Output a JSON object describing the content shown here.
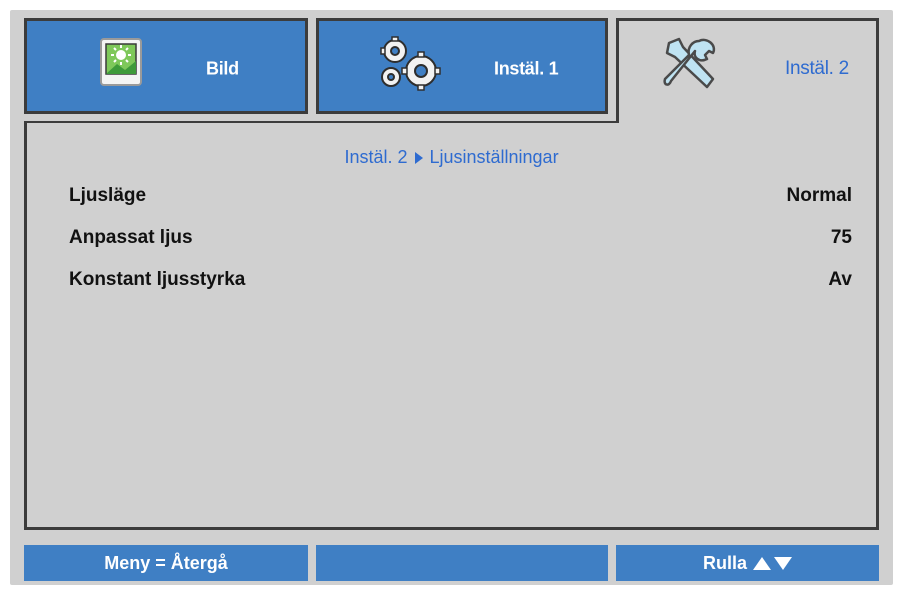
{
  "tabs": [
    {
      "label": "Bild",
      "icon": "picture-icon",
      "active": false
    },
    {
      "label": "Instäl. 1",
      "icon": "gears-icon",
      "active": false
    },
    {
      "label": "Instäl. 2",
      "icon": "tools-icon",
      "active": true
    }
  ],
  "breadcrumb": {
    "parent": "Instäl. 2",
    "current": "Ljusinställningar"
  },
  "settings": [
    {
      "label": "Ljusläge",
      "value": "Normal"
    },
    {
      "label": "Anpassat ljus",
      "value": "75"
    },
    {
      "label": "Konstant ljusstyrka",
      "value": "Av"
    }
  ],
  "footer": {
    "menu_hint": "Meny = Återgå",
    "middle": "",
    "scroll_hint": "Rulla"
  },
  "colors": {
    "tab_blue": "#3f7fc4",
    "panel_grey": "#d0d0d0",
    "accent_text": "#2e6bd0",
    "border": "#3c3c3c"
  }
}
